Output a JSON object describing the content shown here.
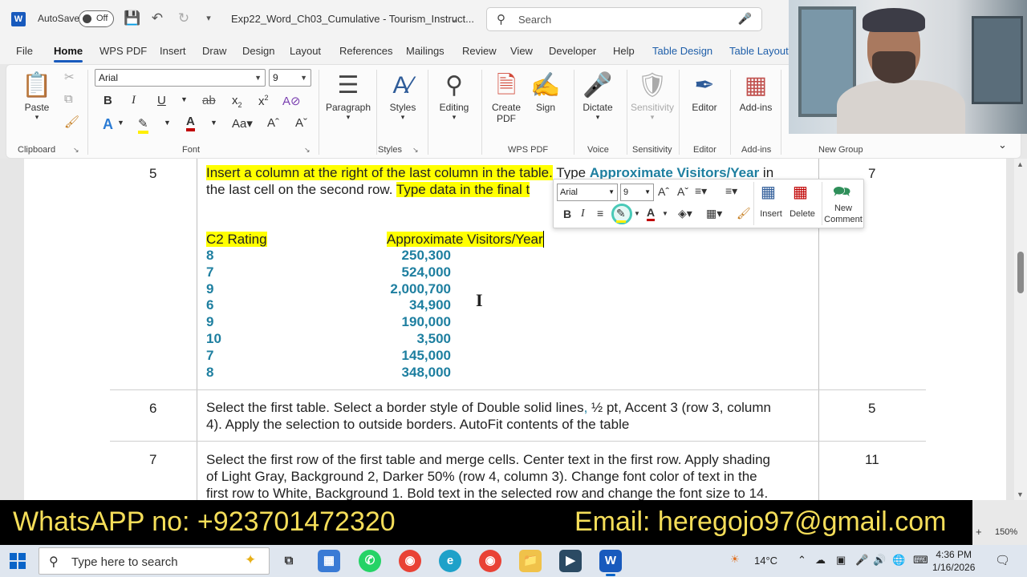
{
  "titlebar": {
    "autosave_label": "AutoSave",
    "autosave_state": "Off",
    "doc_title": "Exp22_Word_Ch03_Cumulative - Tourism_Instruct...",
    "search_placeholder": "Search"
  },
  "menu": {
    "tabs": [
      "File",
      "Home",
      "WPS PDF",
      "Insert",
      "Draw",
      "Design",
      "Layout",
      "References",
      "Mailings",
      "Review",
      "View",
      "Developer",
      "Help",
      "Table Design",
      "Table Layout"
    ],
    "active": "Home"
  },
  "ribbon": {
    "font_name": "Arial",
    "font_size": "9",
    "groups": {
      "clipboard": "Clipboard",
      "font": "Font",
      "styles": "Styles",
      "wps_pdf": "WPS PDF",
      "voice": "Voice",
      "sensitivity": "Sensitivity",
      "editor": "Editor",
      "addins": "Add-ins",
      "new_group": "New Group"
    },
    "buttons": {
      "paste": "Paste",
      "paragraph": "Paragraph",
      "styles": "Styles",
      "editing": "Editing",
      "create_pdf": "Create PDF",
      "sign": "Sign",
      "dictate": "Dictate",
      "sensitivity": "Sensitivity",
      "editor": "Editor",
      "addins": "Add-ins"
    }
  },
  "document": {
    "row5": {
      "num": "5",
      "points": "7",
      "line1_hl": "Insert a column at the right of the last column in the table.",
      "line1_rest_a": " Type ",
      "line1_bold": "Approximate Visitors/Year",
      "line1_rest_b": " in",
      "line2_a": "the last cell on the second row. ",
      "line2_hl": "Type data in the final t",
      "header_rating": "C2 Rating",
      "header_visitors": "Approximate Visitors/Year",
      "ratings": [
        "8",
        "7",
        "9",
        "6",
        "9",
        "10",
        "7",
        "8"
      ],
      "visitors": [
        "250,300",
        "524,000",
        "2,000,700",
        "34,900",
        "190,000",
        "3,500",
        "145,000",
        "348,000"
      ]
    },
    "row6": {
      "num": "6",
      "points": "5",
      "text_a": "Select the first table. Select a border style of Double solid lines",
      "text_comma": ",",
      "text_b": " ½ pt, Accent 3 (row 3, column",
      "line2": "4). Apply the selection to outside borders. AutoFit contents of the table"
    },
    "row7": {
      "num": "7",
      "points": "11",
      "line1": "Select the first row of the first table and merge cells. Center text in the first row. Apply shading",
      "line2": "of Light Gray, Background 2, Darker 50% (row 4, column 3). Change font color of text in the",
      "line3": "first row to White, Background 1. Bold text in the selected row and change the font size to 14."
    }
  },
  "mini_toolbar": {
    "font": "Arial",
    "size": "9",
    "insert": "Insert",
    "delete": "Delete",
    "new_comment": "New Comment"
  },
  "banner": {
    "left": "WhatsAPP no: +923701472320",
    "right": "Email: heregojo97@gmail.com"
  },
  "statusbar": {
    "zoom": "150%"
  },
  "taskbar": {
    "search_placeholder": "Type here to search",
    "weather": "14°C",
    "time": "4:36 PM",
    "date": "1/16/2026"
  },
  "colors": {
    "accent": "#185abd",
    "highlight": "#ffff00",
    "teal_text": "#1e7fa0",
    "banner_text": "#f5de59"
  }
}
